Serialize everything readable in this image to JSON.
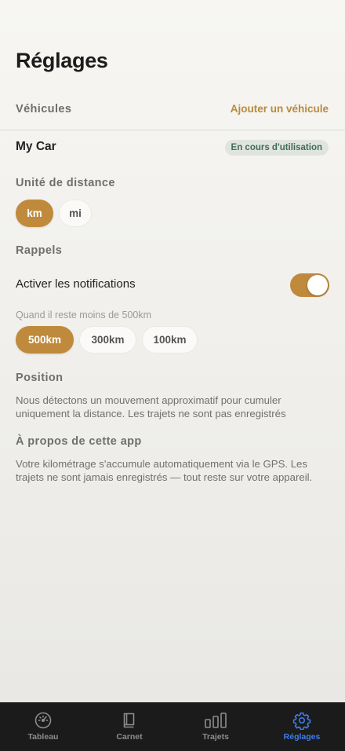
{
  "header": {
    "title": "Réglages"
  },
  "vehicles": {
    "section_label": "Véhicules",
    "add_label": "Ajouter un véhicule",
    "items": [
      {
        "name": "My Car",
        "badge": "En cours d'utilisation"
      }
    ]
  },
  "distance_unit": {
    "section_label": "Unité de distance",
    "options": [
      "km",
      "mi"
    ],
    "selected": "km"
  },
  "reminders": {
    "section_label": "Rappels",
    "notifications_label": "Activer les notifications",
    "notifications_enabled": true,
    "threshold_label": "Quand il reste moins de 500km",
    "threshold_options": [
      "500km",
      "300km",
      "100km"
    ],
    "threshold_selected": "500km"
  },
  "position": {
    "section_label": "Position",
    "text": "Nous détectons un mouvement approximatif pour cumuler uniquement la distance. Les trajets ne sont pas enregistrés"
  },
  "about": {
    "section_label": "À propos de cette app",
    "text": "Votre kilométrage s'accumule automatiquement via le GPS. Les trajets ne sont jamais enregistrés — tout reste sur votre appareil."
  },
  "tabbar": {
    "items": [
      {
        "label": "Tableau",
        "icon": "gauge-icon"
      },
      {
        "label": "Carnet",
        "icon": "book-icon"
      },
      {
        "label": "Trajets",
        "icon": "bar-chart-icon"
      },
      {
        "label": "Réglages",
        "icon": "gear-icon"
      }
    ],
    "active": "Réglages"
  },
  "colors": {
    "accent": "#c08a3c",
    "link": "#b98a3e",
    "badge_text": "#3f6b5a",
    "tab_active": "#3f7ee8",
    "tabbar_bg": "#1b1b1b"
  }
}
